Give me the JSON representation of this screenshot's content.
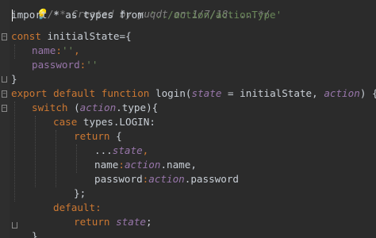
{
  "editor": {
    "top_comment": "/** Created by yuqdt on 1/7/18. ...*/",
    "lines": {
      "l1": {
        "a": "import * as types from ",
        "b": "'../action/actionType'"
      },
      "l3": {
        "a": "const ",
        "b": "initialState={"
      },
      "l4": {
        "a": "name",
        "b": ":",
        "c": "''",
        "d": ","
      },
      "l5": {
        "a": "password",
        "b": ":",
        "c": "''"
      },
      "l6": {
        "a": "}"
      },
      "l8": {
        "a": "export default function ",
        "b": "login(",
        "c": "state",
        "d": " = initialState, ",
        "e": "action",
        "f": ") {"
      },
      "l9": {
        "a": "switch ",
        "b": "(",
        "c": "action",
        "d": ".type){"
      },
      "l10": {
        "a": "case ",
        "b": "types.LOGIN:"
      },
      "l11": {
        "a": "return ",
        "b": "{"
      },
      "l12": {
        "a": "...",
        "b": "state",
        "c": ","
      },
      "l13": {
        "a": "name",
        "b": ":",
        "c": "action",
        "d": ".name,"
      },
      "l14": {
        "a": "password",
        "b": ":",
        "c": "action",
        "d": ".password"
      },
      "l15": {
        "a": "};"
      },
      "l16": {
        "a": "default:"
      },
      "l17": {
        "a": "return ",
        "b": "state",
        "c": ";"
      },
      "l18": {
        "a": "}"
      },
      "l19": {
        "a": "}"
      }
    }
  },
  "colors": {
    "background": "#2b2b2b",
    "keyword": "#cc7832",
    "string": "#6a8759",
    "property": "#9876aa",
    "text": "#c9cfd6"
  },
  "icons": [
    "lightbulb-icon",
    "fold-icon"
  ]
}
